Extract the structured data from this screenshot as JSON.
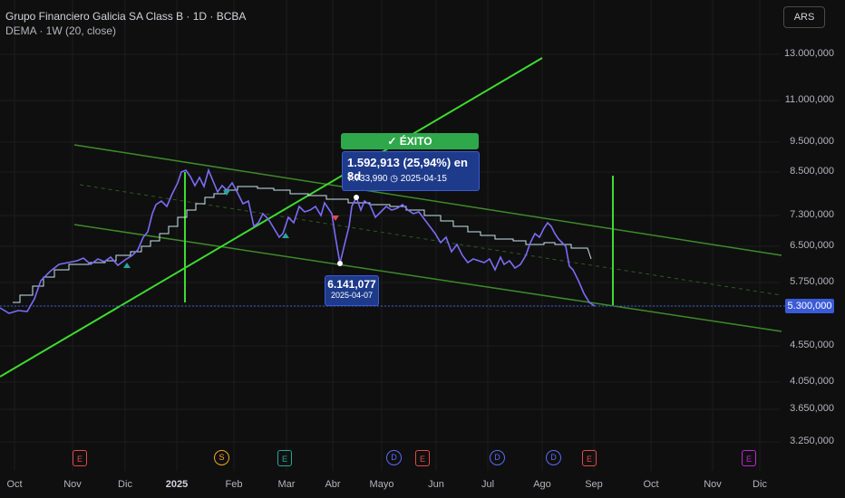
{
  "header": {
    "title": "Grupo Financiero Galicia SA Class B · 1D · BCBA",
    "indicator": "DEMA · 1W (20, close)"
  },
  "currency_button": "ARS",
  "y_axis": {
    "labels": [
      "13.000,000",
      "11.000,000",
      "9.500,000",
      "8.500,000",
      "7.300,000",
      "6.500,000",
      "5.750,000",
      "5.300,000",
      "4.550,000",
      "4.050,000",
      "3.650,000",
      "3.250,000"
    ]
  },
  "x_axis": {
    "labels": [
      "Oct",
      "Nov",
      "Dic",
      "2025",
      "Feb",
      "Mar",
      "Abr",
      "Mayo",
      "Jun",
      "Jul",
      "Ago",
      "Sep",
      "Oct",
      "Nov",
      "Dic"
    ]
  },
  "success_tooltip": {
    "header": "✓ ÉXITO",
    "line1": "1.592,913 (25,94%) en 8d",
    "line2": "7.733,990 ◷ 2025-04-15"
  },
  "low_tooltip": {
    "value": "6.141,077",
    "date": "2025-04-07"
  },
  "price_label": "5.300,000",
  "events": [
    {
      "letter": "E",
      "color": "#e04a4a",
      "shape": "square"
    },
    {
      "letter": "S",
      "color": "#f5a623",
      "shape": "round"
    },
    {
      "letter": "E",
      "color": "#26a69a",
      "shape": "square"
    },
    {
      "letter": "E",
      "color": "#e04a4a",
      "shape": "square"
    },
    {
      "letter": "D",
      "color": "#5b6bf5",
      "shape": "round"
    },
    {
      "letter": "E",
      "color": "#e04a4a",
      "shape": "square"
    },
    {
      "letter": "D",
      "color": "#5b6bf5",
      "shape": "round"
    },
    {
      "letter": "D",
      "color": "#5b6bf5",
      "shape": "round"
    },
    {
      "letter": "E",
      "color": "#e04a4a",
      "shape": "square"
    },
    {
      "letter": "E",
      "color": "#c026d3",
      "shape": "square"
    }
  ],
  "colors": {
    "background": "#0f0f0f",
    "price_line": "#7b6cf6",
    "dema_line": "#c8e6ef",
    "channel": "#3d8b2a",
    "trend": "#3ddc2f",
    "price_marker": "#3b5bd6"
  }
}
